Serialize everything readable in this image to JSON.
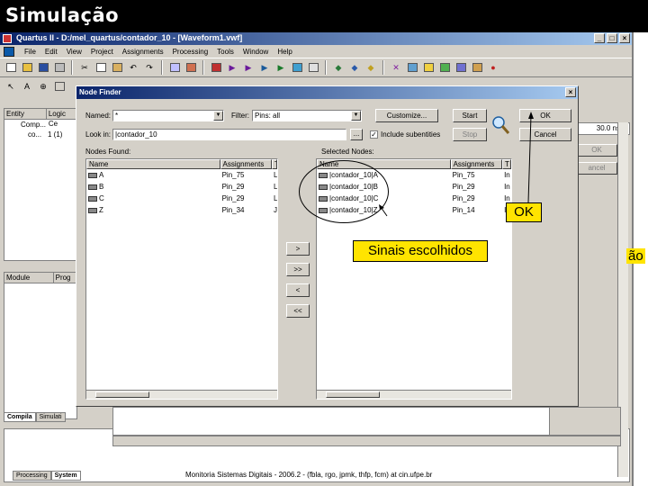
{
  "slide": {
    "title": "Simulação",
    "footer": "Monitoria Sistemas Digitais - 2006.2 - (fbla, rgo, jpmk, thfp, fcm) at cin.ufpe.br"
  },
  "app": {
    "title": "Quartus II - D:/mel_quartus/contador_10 - [Waveform1.vwf]",
    "window_buttons": [
      "_",
      "□",
      "×"
    ],
    "menu": [
      "File",
      "Edit",
      "View",
      "Project",
      "Assignments",
      "Processing",
      "Tools",
      "Window",
      "Help"
    ]
  },
  "hierarchy": {
    "headers": [
      "Entity",
      "Logic Ce"
    ],
    "rows": [
      {
        "name": "Comp...",
        "value": ""
      },
      {
        "name": "co...",
        "value": "1 (1)"
      }
    ]
  },
  "project_pane": {
    "headers": [
      "Module",
      "Prog"
    ]
  },
  "left_tabs": [
    "Compila",
    "Simulati"
  ],
  "message_tabs": [
    "Processing",
    "System"
  ],
  "right_side": {
    "time": "30.0 ns",
    "ok_label": "OK",
    "cancel_label": "ancel",
    "partial_text": "ão"
  },
  "dialog": {
    "title": "Node Finder",
    "named_label": "Named:",
    "named_value": "*",
    "filter_label": "Filter:",
    "filter_value": "Pins: all",
    "lookin_label": "Look in:",
    "lookin_value": "|contador_10",
    "lookin_browse": "...",
    "include_subentities": "Include subentities",
    "customize_button": "Customize...",
    "start_button": "Start",
    "stop_button": "Stop",
    "ok_button": "OK",
    "cancel_button": "Cancel",
    "nodes_found_label": "Nodes Found:",
    "selected_nodes_label": "Selected Nodes:",
    "found_headers": [
      "Name",
      "Assignments",
      "T"
    ],
    "found_rows": [
      {
        "name": "A",
        "assignment": "Pin_75",
        "type": "L"
      },
      {
        "name": "B",
        "assignment": "Pin_29",
        "type": "L"
      },
      {
        "name": "C",
        "assignment": "Pin_29",
        "type": "L"
      },
      {
        "name": "Z",
        "assignment": "Pin_34",
        "type": "J"
      }
    ],
    "selected_headers": [
      "Name",
      "Assignments",
      "T"
    ],
    "selected_rows": [
      {
        "name": "|contador_10|A",
        "assignment": "Pin_75",
        "type": "In"
      },
      {
        "name": "|contador_10|B",
        "assignment": "Pin_29",
        "type": "In"
      },
      {
        "name": "|contador_10|C",
        "assignment": "Pin_29",
        "type": "In"
      },
      {
        "name": "|contador_10|Z",
        "assignment": "Pin_14",
        "type": "In"
      }
    ],
    "move_buttons": [
      ">",
      ">>",
      "<",
      "<<"
    ]
  },
  "annotations": {
    "ok_callout": "OK",
    "signals_callout": "Sinais escolhidos"
  }
}
